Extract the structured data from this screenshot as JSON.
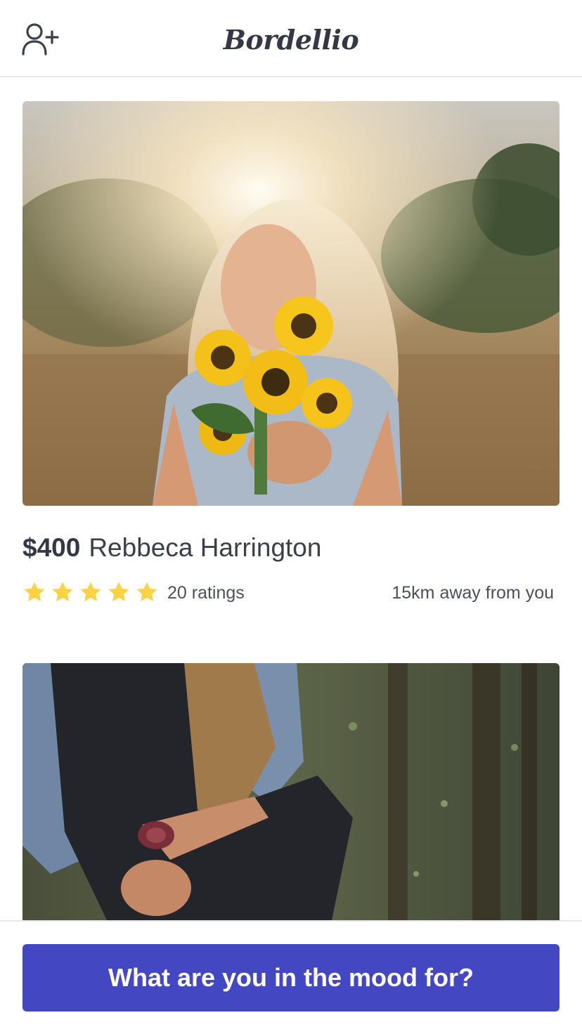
{
  "header": {
    "brand": "Bordellio",
    "add_user_icon": "user-plus-icon"
  },
  "listings": [
    {
      "price": "$400",
      "name": "Rebbeca Harrington",
      "rating_stars": 5,
      "ratings_label": "20 ratings",
      "distance": "15km away from you"
    },
    {}
  ],
  "cta": {
    "label": "What are you in the mood for?"
  },
  "colors": {
    "accent": "#4347c2",
    "star": "#fdd244",
    "text": "#3a3f4a"
  }
}
